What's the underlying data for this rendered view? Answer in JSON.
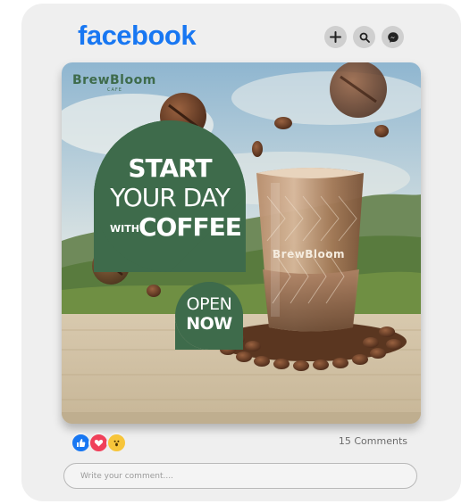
{
  "app": {
    "logo": "facebook"
  },
  "header_icons": [
    {
      "name": "plus-icon"
    },
    {
      "name": "search-icon"
    },
    {
      "name": "messenger-icon"
    }
  ],
  "post": {
    "brand": "BrewBloom",
    "brand_sub": "CAFE",
    "headline": {
      "line1": "START",
      "line2": "YOUR DAY",
      "line3": "WITH",
      "line4": "COFFEE"
    },
    "badge": {
      "line1": "OPEN",
      "line2": "NOW"
    },
    "cup_brand": "BrewBloom",
    "colors": {
      "green": "#3e6b4b",
      "facebook_blue": "#1877f2"
    }
  },
  "footer": {
    "reactions": [
      "like-icon",
      "love-icon",
      "wow-icon"
    ],
    "comments": "15 Comments",
    "comment_placeholder": "Write your comment...."
  }
}
